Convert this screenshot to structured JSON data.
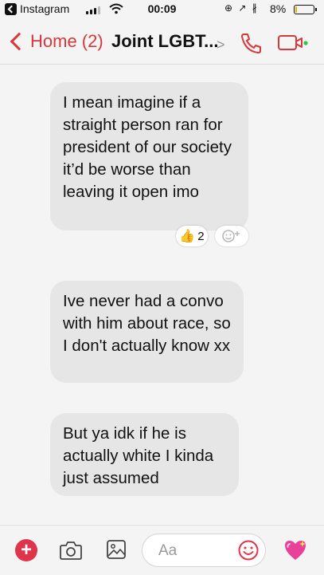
{
  "status_bar": {
    "back_app": "Instagram",
    "time": "00:09",
    "icons": "⊕ ↗ ∦",
    "battery_text": "8%",
    "battery_level_percent": 8
  },
  "nav": {
    "back_label": "Home (2)",
    "title": "Joint LGBT...",
    "title_chevron": ">",
    "accent_color": "#d9383a"
  },
  "messages": [
    {
      "text": "I mean imagine if a straight person ran for president of our society it’d be worse than leaving it open imo"
    },
    {
      "text": "Ive never had a convo with him about race, so I don't actually know xx"
    },
    {
      "text": "But ya idk if he is actually white I kinda just assumed"
    }
  ],
  "reaction": {
    "emoji": "👍",
    "count": "2"
  },
  "composer": {
    "plus_label": "+",
    "placeholder": "Aa"
  },
  "icons": [
    "back-icon",
    "signal-icon",
    "wifi-icon",
    "battery-icon",
    "chevron-left-icon",
    "phone-icon",
    "video-camera-icon",
    "thumbs-up-icon",
    "add-reaction-icon",
    "plus-icon",
    "camera-icon",
    "image-icon",
    "emoji-icon",
    "heart-icon"
  ]
}
